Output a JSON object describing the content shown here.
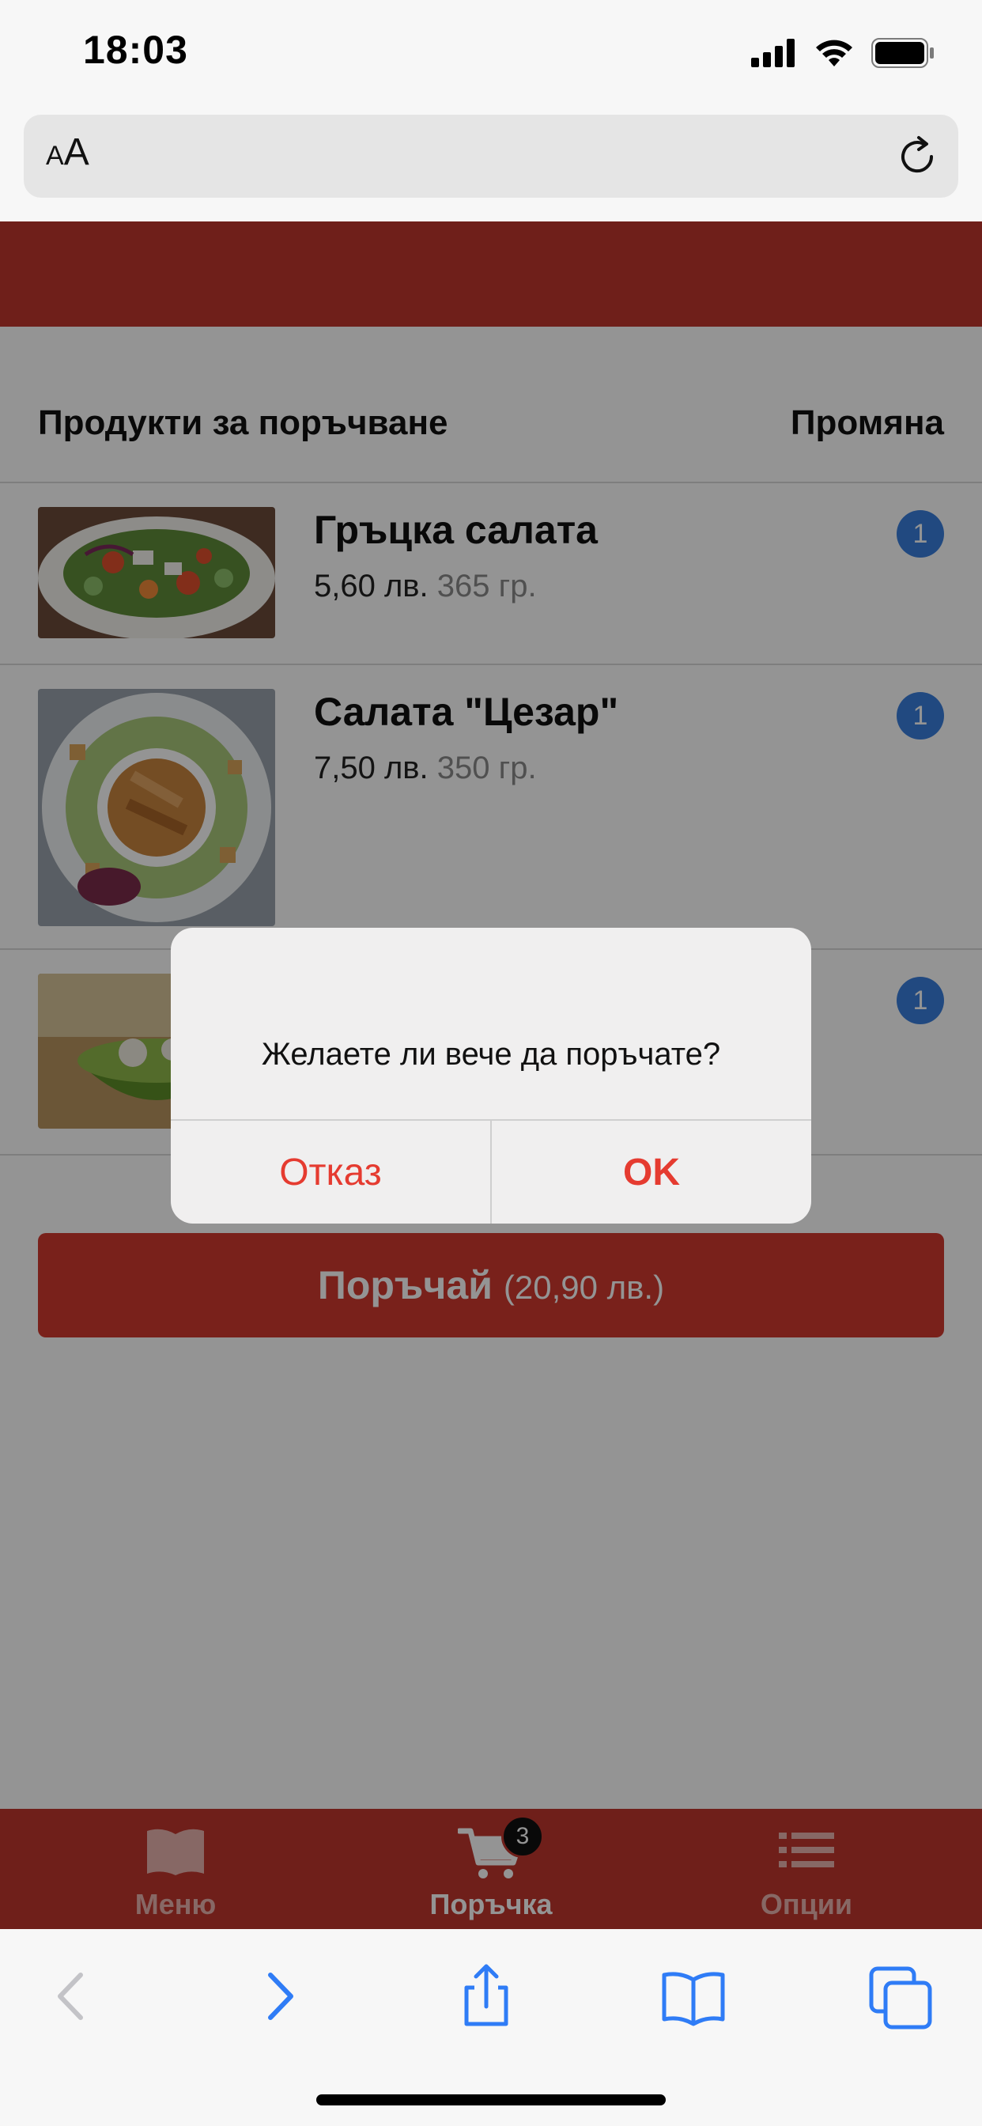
{
  "status_bar": {
    "time": "18:03"
  },
  "address_bar": {
    "text_size_label_small": "A",
    "text_size_label_large": "A"
  },
  "section": {
    "title": "Продукти за поръчване",
    "action": "Промяна"
  },
  "items": [
    {
      "name": "Гръцка салата",
      "price": "5,60 лв.",
      "weight": "365 гр.",
      "qty": "1"
    },
    {
      "name": "Салата \"Цезар\"",
      "price": "7,50 лв.",
      "weight": "350 гр.",
      "qty": "1"
    },
    {
      "name": "",
      "price": "",
      "weight": "",
      "qty": "1"
    }
  ],
  "order_button": {
    "label": "Поръчай",
    "total": "(20,90 лв.)"
  },
  "tabs": [
    {
      "label": "Меню",
      "icon": "book-icon"
    },
    {
      "label": "Поръчка",
      "icon": "cart-icon",
      "badge": "3"
    },
    {
      "label": "Опции",
      "icon": "list-icon"
    }
  ],
  "alert": {
    "message": "Желаете ли вече да поръчате?",
    "cancel_label": "Отказ",
    "ok_label": "OK"
  },
  "colors": {
    "brand_red": "#c0362e",
    "badge_blue": "#3a7fdc",
    "alert_action_red": "#e53b30",
    "ios_blue": "#2f7cf6"
  }
}
